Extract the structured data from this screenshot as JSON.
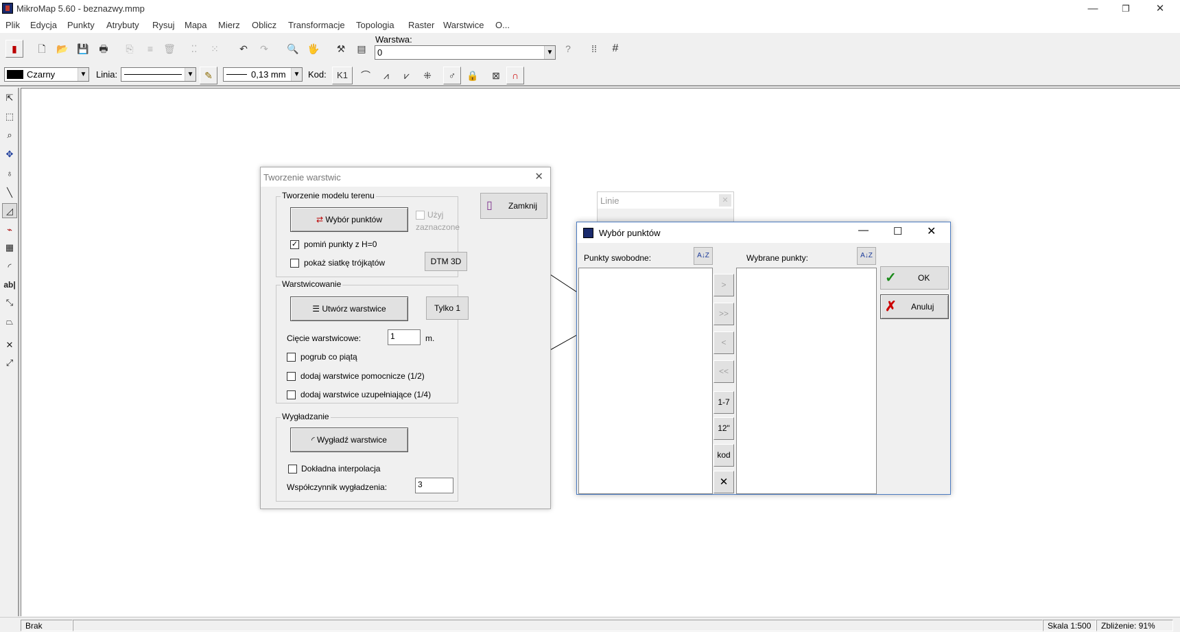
{
  "window": {
    "title": "MikroMap 5.60 - beznazwy.mmp",
    "min": "—",
    "restore": "❐",
    "close": "✕"
  },
  "menu": [
    "Plik",
    "Edycja",
    "Punkty",
    "Atrybuty",
    "Rysuj",
    "Mapa",
    "Mierz",
    "Oblicz",
    "Transformacje",
    "Topologia",
    "Raster",
    "Warstwice",
    "O..."
  ],
  "toolbar": {
    "layer_label": "Warstwa:",
    "layer_value": "0",
    "color_value": "Czarny",
    "line_label": "Linia:",
    "thickness_value": "0,13 mm",
    "code_label": "Kod:",
    "code_value": "K1"
  },
  "status": {
    "left": "Brak",
    "scale": "Skala 1:500",
    "zoom": "Zbliżenie: 91%"
  },
  "linie_panel": {
    "title": "Linie"
  },
  "dlg_warstwice": {
    "title": "Tworzenie warstwic",
    "close_btn": "Zamknij",
    "group_model": "Tworzenie modelu terenu",
    "btn_select_points": "Wybór punktów",
    "use_selected_1": "Użyj",
    "use_selected_2": "zaznaczone",
    "skip_h0": "pomiń punkty z H=0",
    "show_tri": "pokaż siatkę trójkątów",
    "btn_dtm": "DTM 3D",
    "group_contour": "Warstwicowanie",
    "btn_create": "Utwórz warstwice",
    "btn_only1": "Tylko 1",
    "interval_label": "Cięcie warstwicowe:",
    "interval_value": "1",
    "interval_unit": "m.",
    "bold_fifth": "pogrub co piątą",
    "aux_half": "dodaj warstwice pomocnicze (1/2)",
    "aux_quarter": "dodaj warstwice uzupełniające (1/4)",
    "group_smooth": "Wygładzanie",
    "btn_smooth": "Wygładź warstwice",
    "exact_interp": "Dokładna interpolacja",
    "smooth_label": "Współczynnik  wygładzenia:",
    "smooth_value": "3"
  },
  "dlg_points": {
    "title": "Wybór punktów",
    "free_label": "Punkty swobodne:",
    "selected_label": "Wybrane punkty:",
    "btn_add": ">",
    "btn_add_all": ">>",
    "btn_remove": "<",
    "btn_remove_all": "<<",
    "btn_range": "1-7",
    "btn_num": "12\"",
    "btn_code": "kod",
    "btn_clear": "✕",
    "ok": "OK",
    "cancel": "Anuluj",
    "sort_icon": "A↓Z"
  }
}
